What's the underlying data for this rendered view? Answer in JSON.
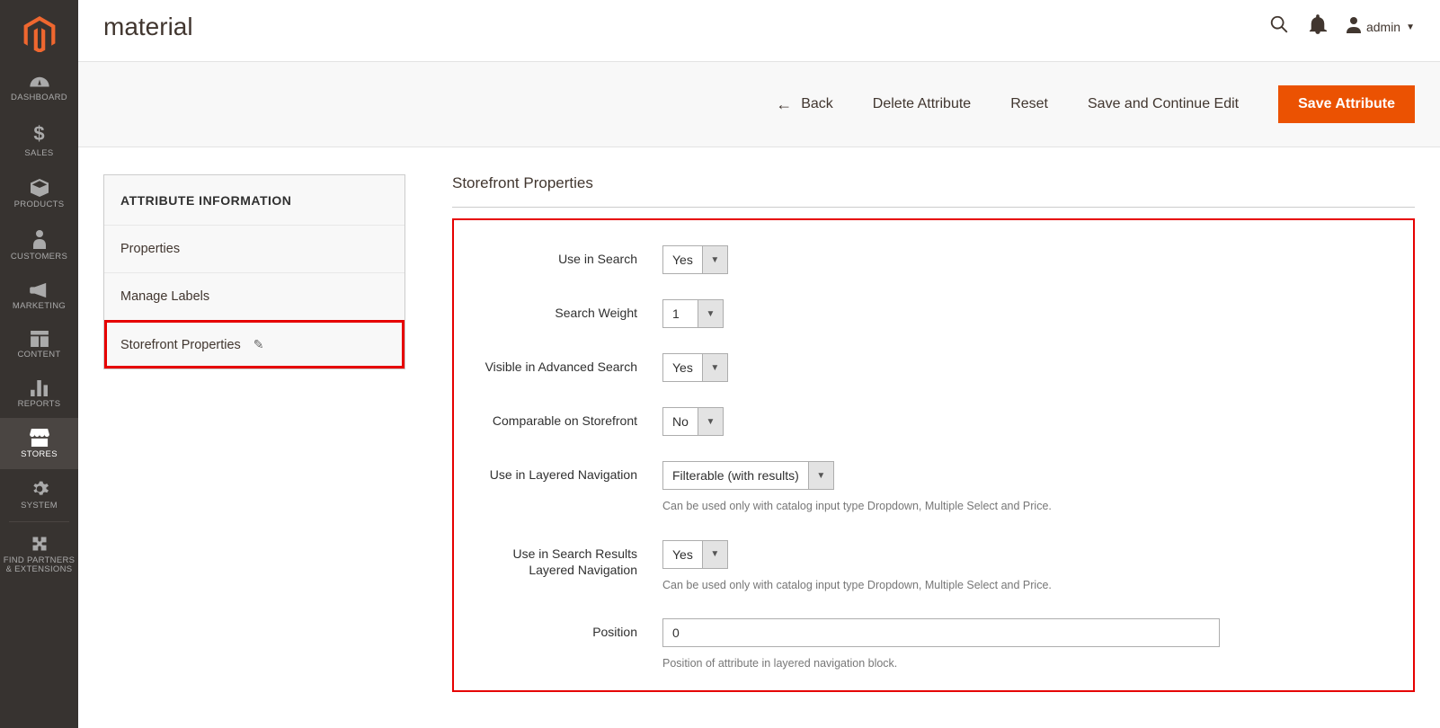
{
  "header": {
    "page_title": "material",
    "account_label": "admin"
  },
  "nav": {
    "items": [
      {
        "label": "DASHBOARD"
      },
      {
        "label": "SALES"
      },
      {
        "label": "PRODUCTS"
      },
      {
        "label": "CUSTOMERS"
      },
      {
        "label": "MARKETING"
      },
      {
        "label": "CONTENT"
      },
      {
        "label": "REPORTS"
      },
      {
        "label": "STORES"
      },
      {
        "label": "SYSTEM"
      },
      {
        "label": "FIND PARTNERS\n& EXTENSIONS"
      }
    ]
  },
  "actions": {
    "back": "Back",
    "delete": "Delete Attribute",
    "reset": "Reset",
    "save_continue": "Save and Continue Edit",
    "save": "Save Attribute"
  },
  "side_panel": {
    "heading": "ATTRIBUTE INFORMATION",
    "items": [
      {
        "label": "Properties"
      },
      {
        "label": "Manage Labels"
      },
      {
        "label": "Storefront Properties"
      }
    ]
  },
  "form": {
    "section_title": "Storefront Properties",
    "fields": {
      "use_in_search": {
        "label": "Use in Search",
        "value": "Yes"
      },
      "search_weight": {
        "label": "Search Weight",
        "value": "1"
      },
      "visible_advanced": {
        "label": "Visible in Advanced Search",
        "value": "Yes"
      },
      "comparable": {
        "label": "Comparable on Storefront",
        "value": "No"
      },
      "layered_nav": {
        "label": "Use in Layered Navigation",
        "value": "Filterable (with results)",
        "hint": "Can be used only with catalog input type Dropdown, Multiple Select and Price."
      },
      "search_layered": {
        "label": "Use in Search Results Layered Navigation",
        "value": "Yes",
        "hint": "Can be used only with catalog input type Dropdown, Multiple Select and Price."
      },
      "position": {
        "label": "Position",
        "value": "0",
        "hint": "Position of attribute in layered navigation block."
      }
    }
  }
}
